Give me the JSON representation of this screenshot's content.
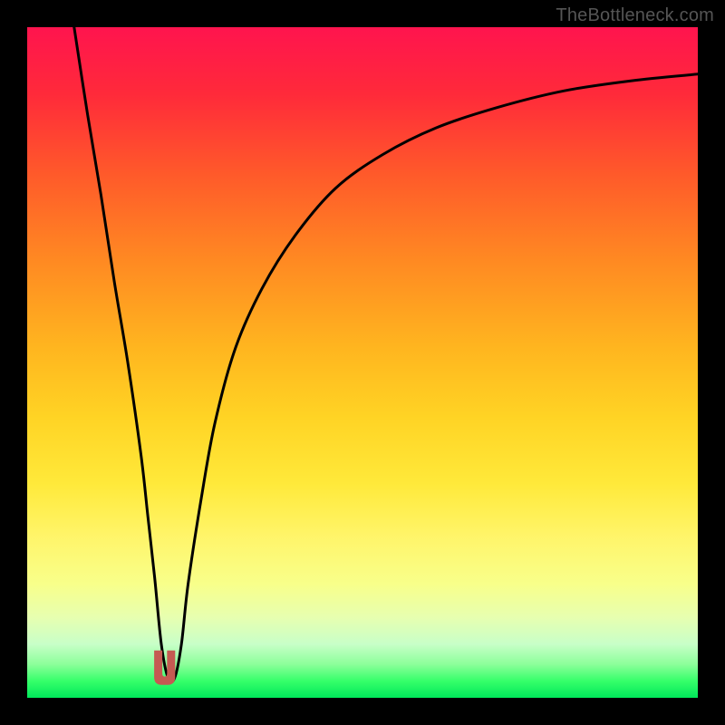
{
  "watermark": "TheBottleneck.com",
  "chart_data": {
    "type": "line",
    "title": "",
    "xlabel": "",
    "ylabel": "",
    "xlim": [
      0,
      100
    ],
    "ylim": [
      0,
      100
    ],
    "legend": false,
    "grid": false,
    "gradient_stops": [
      {
        "pos": 0,
        "color": "#ff144e"
      },
      {
        "pos": 10,
        "color": "#ff2a3a"
      },
      {
        "pos": 22,
        "color": "#ff5a2a"
      },
      {
        "pos": 35,
        "color": "#ff8a22"
      },
      {
        "pos": 48,
        "color": "#ffb61f"
      },
      {
        "pos": 58,
        "color": "#ffd324"
      },
      {
        "pos": 68,
        "color": "#ffe93a"
      },
      {
        "pos": 76,
        "color": "#fff56a"
      },
      {
        "pos": 83,
        "color": "#f8ff8a"
      },
      {
        "pos": 88,
        "color": "#e7ffb0"
      },
      {
        "pos": 92,
        "color": "#c8ffc8"
      },
      {
        "pos": 95,
        "color": "#8cff9a"
      },
      {
        "pos": 97.5,
        "color": "#36ff6a"
      },
      {
        "pos": 100,
        "color": "#00e85a"
      }
    ],
    "series": [
      {
        "name": "bottleneck-curve",
        "x": [
          7,
          9,
          11,
          13,
          15,
          17,
          18,
          19,
          20,
          21,
          22,
          23,
          24,
          26,
          28,
          31,
          35,
          40,
          46,
          53,
          61,
          70,
          80,
          90,
          100
        ],
        "y": [
          100,
          87,
          75,
          62,
          50,
          36,
          27,
          18,
          8,
          3,
          3,
          8,
          17,
          30,
          41,
          52,
          61,
          69,
          76,
          81,
          85,
          88,
          90.5,
          92,
          93
        ]
      }
    ],
    "marker": {
      "name": "optimal-point-marker",
      "shape": "u-notch",
      "x_center": 20.5,
      "x_width": 3,
      "y_top": 7,
      "y_bottom": 2,
      "color": "#c55a52"
    }
  }
}
